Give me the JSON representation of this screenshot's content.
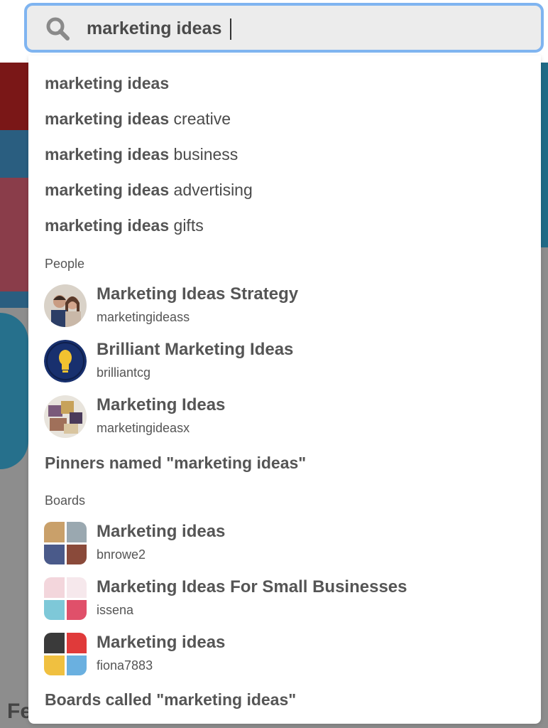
{
  "search": {
    "value": "marketing ideas"
  },
  "suggestions": [
    {
      "bold": "marketing ideas",
      "rest": ""
    },
    {
      "bold": "marketing ideas",
      "rest": " creative"
    },
    {
      "bold": "marketing ideas",
      "rest": " business"
    },
    {
      "bold": "marketing ideas",
      "rest": " advertising"
    },
    {
      "bold": "marketing ideas",
      "rest": " gifts"
    }
  ],
  "people": {
    "label": "People",
    "items": [
      {
        "name": "Marketing Ideas Strategy",
        "handle": "marketingideass"
      },
      {
        "name": "Brilliant Marketing Ideas",
        "handle": "brilliantcg"
      },
      {
        "name": "Marketing Ideas",
        "handle": "marketingideasx"
      }
    ],
    "see_all": "Pinners named \"marketing ideas\""
  },
  "boards": {
    "label": "Boards",
    "items": [
      {
        "name": "Marketing ideas",
        "owner": "bnrowe2"
      },
      {
        "name": "Marketing Ideas For Small Businesses",
        "owner": "issena"
      },
      {
        "name": "Marketing ideas",
        "owner": "fiona7883"
      }
    ],
    "see_all": "Boards called \"marketing ideas\""
  },
  "background": {
    "left_heading_fragment": "Fe"
  },
  "colors": {
    "search_border": "#7fb4f0",
    "overlay": "#8d8d8d",
    "text": "#555555"
  }
}
